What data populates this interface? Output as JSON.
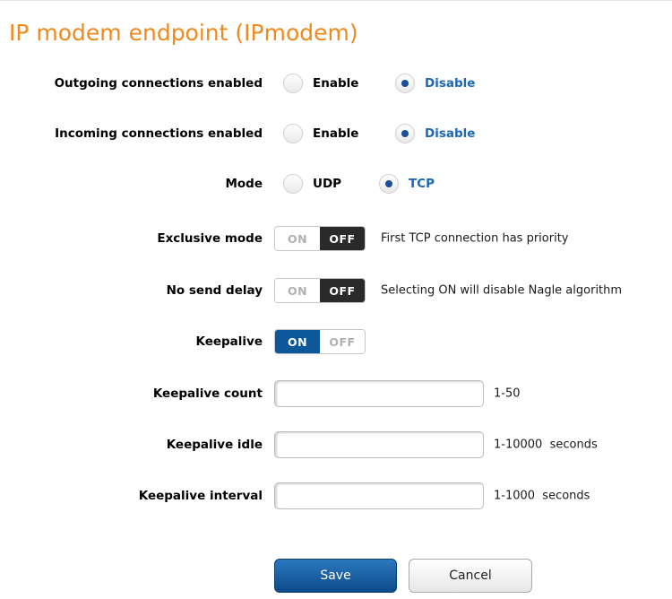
{
  "title": "IP modem endpoint (IPmodem)",
  "outgoing": {
    "label": "Outgoing connections enabled",
    "options": [
      "Enable",
      "Disable"
    ],
    "selected": "Disable"
  },
  "incoming": {
    "label": "Incoming connections enabled",
    "options": [
      "Enable",
      "Disable"
    ],
    "selected": "Disable"
  },
  "mode": {
    "label": "Mode",
    "options": [
      "UDP",
      "TCP"
    ],
    "selected": "TCP"
  },
  "exclusive_mode": {
    "label": "Exclusive mode",
    "on_label": "ON",
    "off_label": "OFF",
    "state": "OFF",
    "hint": "First TCP connection has priority"
  },
  "no_send_delay": {
    "label": "No send delay",
    "on_label": "ON",
    "off_label": "OFF",
    "state": "OFF",
    "hint": "Selecting ON will disable Nagle algorithm"
  },
  "keepalive": {
    "label": "Keepalive",
    "on_label": "ON",
    "off_label": "OFF",
    "state": "ON"
  },
  "keepalive_count": {
    "label": "Keepalive count",
    "value": "",
    "range": "1-50"
  },
  "keepalive_idle": {
    "label": "Keepalive idle",
    "value": "",
    "range": "1-10000  seconds"
  },
  "keepalive_interval": {
    "label": "Keepalive interval",
    "value": "",
    "range": "1-1000  seconds"
  },
  "buttons": {
    "save": "Save",
    "cancel": "Cancel"
  },
  "colors": {
    "title": "#ef8a1f",
    "selected_text": "#1e66b8",
    "radio_dot": "#1b4e9c",
    "toggle_on": "#0b5799",
    "toggle_off": "#2a2a2a",
    "save_button": "#0c4b8a"
  }
}
